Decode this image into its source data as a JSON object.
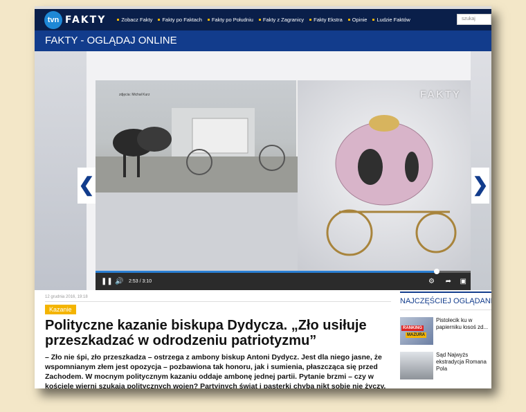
{
  "navbar": {
    "logo_circle": "tvn",
    "logo_text": "FAKTY",
    "items": [
      "Zobacz Fakty",
      "Fakty po Faktach",
      "Fakty po Południu",
      "Fakty z Zagranicy",
      "Fakty Ekstra",
      "Opinie",
      "Ludzie Faktów"
    ],
    "search_placeholder": "szukaj"
  },
  "page_title": "FAKTY - OGLĄDAJ ONLINE",
  "player": {
    "watermark": "FAKTY",
    "credit": "zdjęcia: Michał Kurz",
    "time": "2:53 / 3:10",
    "progress": 0.91
  },
  "article": {
    "date": "12 grudnia 2016, 19:18",
    "tag": "Kazanie",
    "headline": "Polityczne kazanie biskupa Dydycza. „Zło usiłuje przeszkadzać w odrodzeniu patriotyzmu”",
    "lead": "– Zło nie śpi, zło przeszkadza – ostrzega z ambony biskup Antoni Dydycz. Jest dla niego jasne, że wspomnianym złem jest opozycja – pozbawiona tak honoru, jak i sumienia, płaszcząca się przed Zachodem. W mocnym politycznym kazaniu oddaje ambonę jednej partii. Pytanie brzmi – czy w kościele wierni szukają politycznych wojen? Partyjnych świąt i pasterki chyba nikt sobie nie życzy."
  },
  "sidebar": {
    "title": "NAJCZĘŚCIEJ OGLĄDANE",
    "items": [
      {
        "text": "Pistolecik ku w papierniku łosoś zd...",
        "badge1": "RANKING",
        "badge2": "MAZURA"
      },
      {
        "text": "Sąd Najwyżs ekstradycja Romana Pola"
      }
    ]
  },
  "icons": {
    "left_arrow": "chevron-left-icon",
    "right_arrow": "chevron-right-icon"
  }
}
